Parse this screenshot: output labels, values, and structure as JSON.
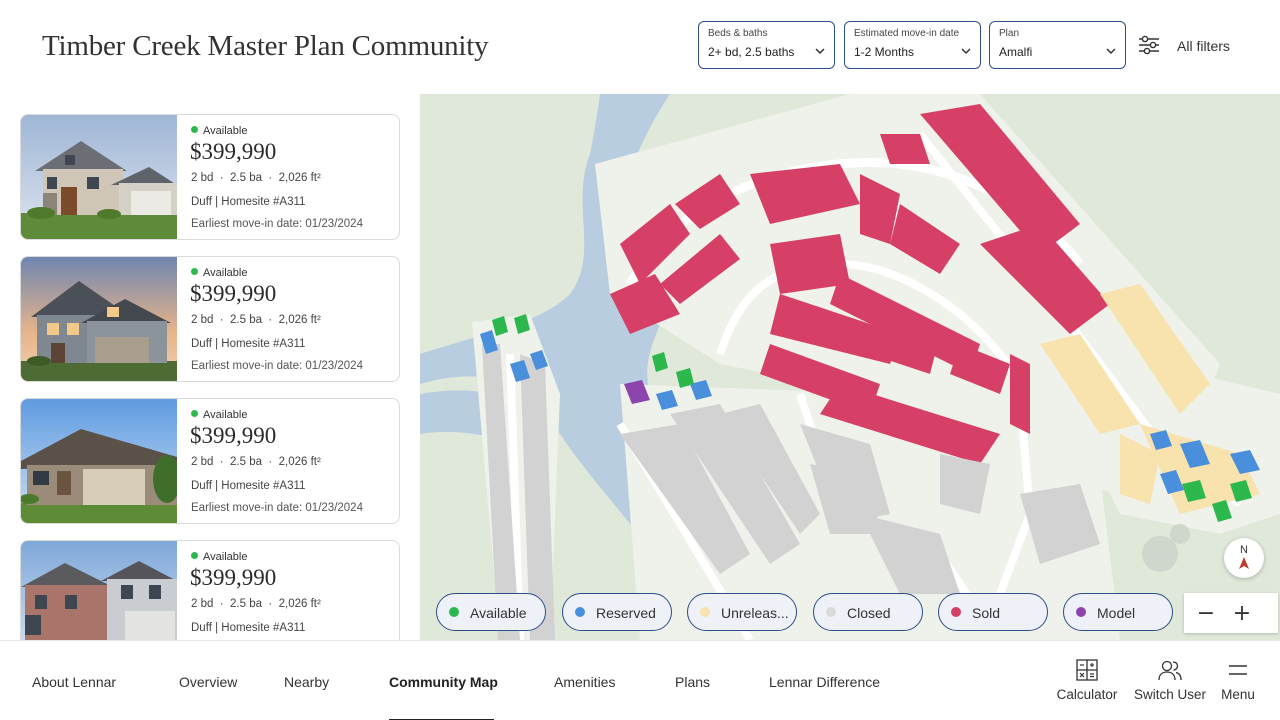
{
  "header": {
    "title": "Timber Creek Master Plan Community",
    "filters": [
      {
        "label": "Beds & baths",
        "value": "2+ bd, 2.5 baths"
      },
      {
        "label": "Estimated move-in date",
        "value": "1-2 Months"
      },
      {
        "label": "Plan",
        "value": "Amalfi"
      }
    ],
    "all_filters": "All filters"
  },
  "listings": [
    {
      "status": "Available",
      "price": "$399,990",
      "beds": "2 bd",
      "baths": "2.5 ba",
      "sqft": "2,026 ft²",
      "lot": "Duff | Homesite #A311",
      "move_in": "Earliest move-in date: 01/23/2024"
    },
    {
      "status": "Available",
      "price": "$399,990",
      "beds": "2 bd",
      "baths": "2.5 ba",
      "sqft": "2,026 ft²",
      "lot": "Duff | Homesite #A311",
      "move_in": "Earliest move-in date: 01/23/2024"
    },
    {
      "status": "Available",
      "price": "$399,990",
      "beds": "2 bd",
      "baths": "2.5 ba",
      "sqft": "2,026 ft²",
      "lot": "Duff | Homesite #A311",
      "move_in": "Earliest move-in date: 01/23/2024"
    },
    {
      "status": "Available",
      "price": "$399,990",
      "beds": "2 bd",
      "baths": "2.5 ba",
      "sqft": "2,026 ft²",
      "lot": "Duff | Homesite #A311",
      "move_in": ""
    }
  ],
  "spec_separator": "·",
  "map": {
    "compass": "N",
    "legend": [
      {
        "label": "Available",
        "color": "#2db84d"
      },
      {
        "label": "Reserved",
        "color": "#4a8fdc"
      },
      {
        "label": "Unreleas...",
        "color": "#f8e2ad"
      },
      {
        "label": "Closed",
        "color": "#d9d9d9"
      },
      {
        "label": "Sold",
        "color": "#d63f66"
      },
      {
        "label": "Model",
        "color": "#8e44ad"
      }
    ],
    "zoom_out": "−",
    "zoom_in": "+"
  },
  "bottom_nav": {
    "items": [
      "About Lennar",
      "Overview",
      "Nearby",
      "Community Map",
      "Amenities",
      "Plans",
      "Lennar Difference"
    ],
    "active": "Community Map",
    "tools": [
      {
        "label": "Calculator",
        "icon": "calculator-icon"
      },
      {
        "label": "Switch User",
        "icon": "users-icon"
      },
      {
        "label": "Menu",
        "icon": "hamburger-icon"
      }
    ]
  },
  "colors": {
    "sold": "#d63f66",
    "available": "#2db84d",
    "reserved": "#4a8fdc",
    "unreleased": "#f8e2ad",
    "closed": "#d9d9d9",
    "model": "#8e44ad",
    "water": "#b9cde1",
    "land": "#dfe8d9",
    "accent_border": "#2f4f8a"
  }
}
